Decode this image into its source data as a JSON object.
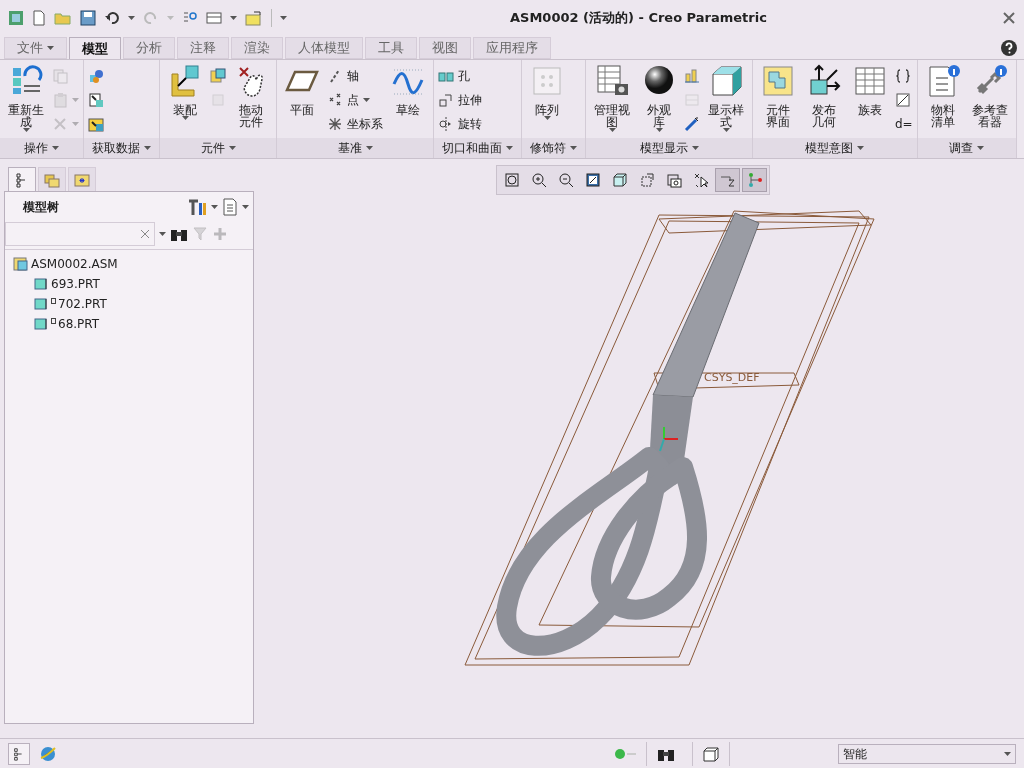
{
  "window": {
    "title": "ASM0002 (活动的) - Creo Parametric"
  },
  "tabs": [
    {
      "label": "文件",
      "dropdown": true,
      "selected": false
    },
    {
      "label": "模型",
      "selected": true
    },
    {
      "label": "分析",
      "selected": false
    },
    {
      "label": "注释",
      "selected": false
    },
    {
      "label": "渲染",
      "selected": false
    },
    {
      "label": "人体模型",
      "selected": false
    },
    {
      "label": "工具",
      "selected": false
    },
    {
      "label": "视图",
      "selected": false
    },
    {
      "label": "应用程序",
      "selected": false
    }
  ],
  "ribbon": {
    "groups": [
      {
        "label": "操作",
        "items": [
          {
            "kind": "large",
            "lines": [
              "重新生",
              "成"
            ],
            "caret": true
          },
          {
            "kind": "stack",
            "entries": [
              {
                "disabled": true
              },
              {
                "caret": true,
                "disabled": true
              },
              {
                "caret": true,
                "disabled": true
              }
            ]
          }
        ]
      },
      {
        "label": "获取数据",
        "items": [
          {
            "kind": "stack",
            "entries": [
              {
                "disabled": false
              },
              {
                "disabled": false
              },
              {
                "disabled": false
              }
            ]
          }
        ]
      },
      {
        "label": "元件",
        "items": [
          {
            "kind": "large",
            "lines": [
              "装配"
            ],
            "caret": true
          },
          {
            "kind": "stack",
            "entries": [
              {
                "disabled": false
              },
              {
                "disabled": true
              }
            ]
          },
          {
            "kind": "large",
            "lines": [
              "拖动",
              "元件"
            ]
          }
        ]
      },
      {
        "label": "基准",
        "items": [
          {
            "kind": "large",
            "lines": [
              "平面"
            ]
          },
          {
            "kind": "stack",
            "entries": [
              {
                "label": "轴",
                "disabled": false
              },
              {
                "label": "点",
                "caret": true,
                "disabled": false
              },
              {
                "label": "坐标系",
                "disabled": false
              }
            ]
          },
          {
            "kind": "large",
            "lines": [
              "草绘"
            ]
          }
        ]
      },
      {
        "label": "切口和曲面",
        "items": [
          {
            "kind": "stack",
            "entries": [
              {
                "label": "孔",
                "disabled": false
              },
              {
                "label": "拉伸",
                "disabled": false
              },
              {
                "label": "旋转",
                "disabled": false
              }
            ]
          }
        ]
      },
      {
        "label": "修饰符",
        "items": [
          {
            "kind": "large",
            "lines": [
              "阵列"
            ],
            "caret": true
          }
        ]
      },
      {
        "label": "模型显示",
        "items": [
          {
            "kind": "large",
            "lines": [
              "管理视",
              "图"
            ],
            "caret": true
          },
          {
            "kind": "large",
            "lines": [
              "外观",
              "库"
            ],
            "caret": true
          },
          {
            "kind": "stack",
            "entries": [
              {
                "disabled": false
              },
              {
                "disabled": true
              },
              {
                "disabled": false
              }
            ]
          },
          {
            "kind": "large",
            "lines": [
              "显示样",
              "式"
            ],
            "caret": true
          }
        ]
      },
      {
        "label": "模型意图",
        "items": [
          {
            "kind": "large",
            "lines": [
              "元件",
              "界面"
            ]
          },
          {
            "kind": "large",
            "lines": [
              "发布",
              "几何"
            ]
          },
          {
            "kind": "large",
            "lines": [
              "族表"
            ]
          },
          {
            "kind": "stack",
            "entries": [
              {
                "disabled": false
              },
              {
                "disabled": false
              },
              {
                "label": "d=",
                "disabled": false
              }
            ]
          }
        ]
      },
      {
        "label": "调查",
        "items": [
          {
            "kind": "large",
            "lines": [
              "物料",
              "清单"
            ]
          },
          {
            "kind": "large",
            "lines": [
              "参考查",
              "看器"
            ]
          }
        ]
      }
    ]
  },
  "side_tabs": [
    {
      "selected": true
    },
    {
      "selected": false
    },
    {
      "selected": false
    }
  ],
  "model_tree": {
    "title": "模型树",
    "items": [
      {
        "name": "ASM0002.ASM",
        "children": [
          {
            "name": "693.PRT"
          },
          {
            "name": "702.PRT",
            "marker": true
          },
          {
            "name": "68.PRT",
            "marker": true
          }
        ]
      }
    ]
  },
  "view_toolbar": [
    {
      "selected": false
    },
    {
      "selected": false
    },
    {
      "selected": false
    },
    {
      "selected": false
    },
    {
      "selected": false
    },
    {
      "selected": false
    },
    {
      "selected": false
    },
    {
      "selected": false
    },
    {
      "selected": true
    },
    {
      "selected": true
    }
  ],
  "graphics": {
    "labels": [
      "CSYS_DEF"
    ]
  },
  "status_bar": {
    "filter": "智能"
  }
}
